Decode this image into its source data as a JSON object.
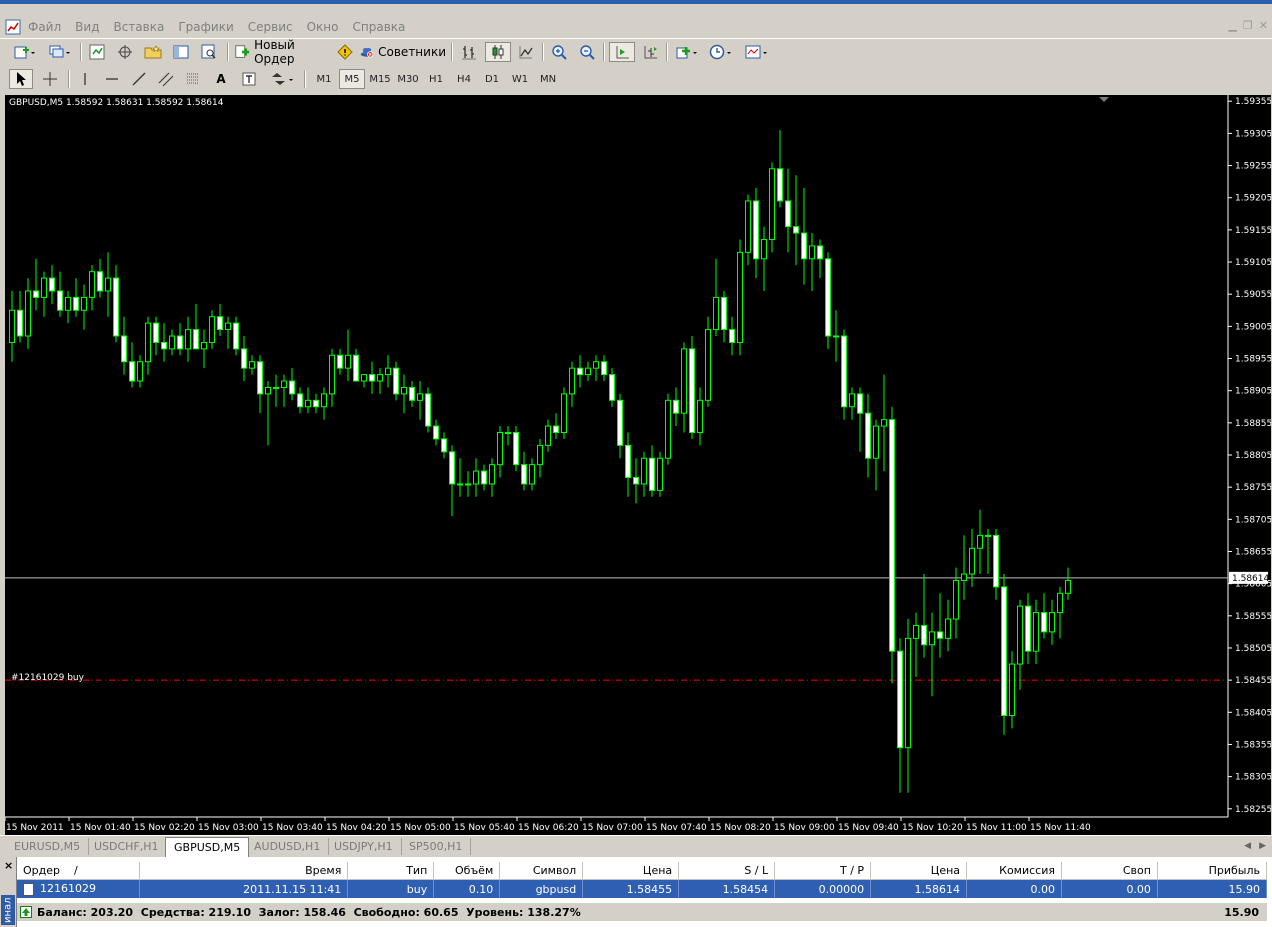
{
  "menu": [
    "Файл",
    "Вид",
    "Вставка",
    "Графики",
    "Сервис",
    "Окно",
    "Справка"
  ],
  "toolbar": {
    "new_order_label": "Новый Ордер",
    "advisors_label": "Советники",
    "timeframes": [
      "M1",
      "M5",
      "M15",
      "M30",
      "H1",
      "H4",
      "D1",
      "W1",
      "MN"
    ],
    "active_timeframe": "M5",
    "text_tool_label": "A"
  },
  "chart": {
    "title": "GBPUSD,M5  1.58592 1.58631 1.58592 1.58614",
    "order_line_label": "#12161029 buy",
    "current_price_label": "1.58614",
    "colors": {
      "background": "#000000",
      "candle": "#00ff00",
      "order_line": "#ff0000",
      "price_line": "#c0c0c0",
      "axis_text": "#ffffff"
    }
  },
  "chart_data": {
    "type": "candlestick",
    "symbol": "GBPUSD",
    "timeframe": "M5",
    "x_axis_labels": [
      "15 Nov 2011",
      "15 Nov 01:40",
      "15 Nov 02:20",
      "15 Nov 03:00",
      "15 Nov 03:40",
      "15 Nov 04:20",
      "15 Nov 05:00",
      "15 Nov 05:40",
      "15 Nov 06:20",
      "15 Nov 07:00",
      "15 Nov 07:40",
      "15 Nov 08:20",
      "15 Nov 09:00",
      "15 Nov 09:40",
      "15 Nov 10:20",
      "15 Nov 11:00",
      "15 Nov 11:40"
    ],
    "y_ticks": [
      "1.59355",
      "1.59305",
      "1.59255",
      "1.59205",
      "1.59155",
      "1.59105",
      "1.59055",
      "1.59005",
      "1.58955",
      "1.58905",
      "1.58855",
      "1.58805",
      "1.58755",
      "1.58705",
      "1.58655",
      "1.58605",
      "1.58555",
      "1.58505",
      "1.58455",
      "1.58405",
      "1.58355",
      "1.58305",
      "1.58255"
    ],
    "ylim": [
      1.5825,
      1.5936
    ],
    "current_price": 1.58614,
    "order_price": 1.58455,
    "candles_comment": "t = minutes elapsed from the first tick label 15 Nov 2011 (00:xx) at the leftmost edge; each candle is 5 minutes",
    "candles": [
      {
        "t": 0,
        "o": 1.5898,
        "h": 1.5906,
        "l": 1.5895,
        "c": 1.5903
      },
      {
        "t": 5,
        "o": 1.5903,
        "h": 1.5906,
        "l": 1.5898,
        "c": 1.5899
      },
      {
        "t": 10,
        "o": 1.5899,
        "h": 1.5908,
        "l": 1.5897,
        "c": 1.5906
      },
      {
        "t": 15,
        "o": 1.5906,
        "h": 1.5911,
        "l": 1.5903,
        "c": 1.5905
      },
      {
        "t": 20,
        "o": 1.5905,
        "h": 1.5909,
        "l": 1.5902,
        "c": 1.5908
      },
      {
        "t": 25,
        "o": 1.5908,
        "h": 1.591,
        "l": 1.5904,
        "c": 1.5906
      },
      {
        "t": 30,
        "o": 1.5906,
        "h": 1.5909,
        "l": 1.5902,
        "c": 1.5903
      },
      {
        "t": 35,
        "o": 1.5903,
        "h": 1.5906,
        "l": 1.5901,
        "c": 1.5905
      },
      {
        "t": 40,
        "o": 1.5905,
        "h": 1.5908,
        "l": 1.5902,
        "c": 1.5903
      },
      {
        "t": 45,
        "o": 1.5903,
        "h": 1.5907,
        "l": 1.59,
        "c": 1.5905
      },
      {
        "t": 50,
        "o": 1.5905,
        "h": 1.591,
        "l": 1.5903,
        "c": 1.5909
      },
      {
        "t": 55,
        "o": 1.5909,
        "h": 1.5911,
        "l": 1.5905,
        "c": 1.5906
      },
      {
        "t": 60,
        "o": 1.5906,
        "h": 1.5912,
        "l": 1.5902,
        "c": 1.5908
      },
      {
        "t": 65,
        "o": 1.5908,
        "h": 1.591,
        "l": 1.5898,
        "c": 1.5899
      },
      {
        "t": 70,
        "o": 1.5899,
        "h": 1.5902,
        "l": 1.5893,
        "c": 1.5895
      },
      {
        "t": 75,
        "o": 1.5895,
        "h": 1.5898,
        "l": 1.5891,
        "c": 1.5892
      },
      {
        "t": 80,
        "o": 1.5892,
        "h": 1.5896,
        "l": 1.5891,
        "c": 1.5895
      },
      {
        "t": 85,
        "o": 1.5895,
        "h": 1.5902,
        "l": 1.5893,
        "c": 1.5901
      },
      {
        "t": 90,
        "o": 1.5901,
        "h": 1.5902,
        "l": 1.5896,
        "c": 1.5898
      },
      {
        "t": 95,
        "o": 1.5898,
        "h": 1.5901,
        "l": 1.5895,
        "c": 1.5897
      },
      {
        "t": 100,
        "o": 1.5897,
        "h": 1.59,
        "l": 1.5896,
        "c": 1.5899
      },
      {
        "t": 105,
        "o": 1.5899,
        "h": 1.5901,
        "l": 1.5896,
        "c": 1.5897
      },
      {
        "t": 110,
        "o": 1.5897,
        "h": 1.5902,
        "l": 1.5895,
        "c": 1.59
      },
      {
        "t": 115,
        "o": 1.59,
        "h": 1.5904,
        "l": 1.5897,
        "c": 1.5897
      },
      {
        "t": 120,
        "o": 1.5897,
        "h": 1.59,
        "l": 1.5894,
        "c": 1.5898
      },
      {
        "t": 125,
        "o": 1.5898,
        "h": 1.5903,
        "l": 1.5897,
        "c": 1.5902
      },
      {
        "t": 130,
        "o": 1.5902,
        "h": 1.5904,
        "l": 1.5899,
        "c": 1.59
      },
      {
        "t": 135,
        "o": 1.59,
        "h": 1.5902,
        "l": 1.5897,
        "c": 1.5901
      },
      {
        "t": 140,
        "o": 1.5901,
        "h": 1.5902,
        "l": 1.5896,
        "c": 1.5897
      },
      {
        "t": 145,
        "o": 1.5897,
        "h": 1.5899,
        "l": 1.5892,
        "c": 1.5894
      },
      {
        "t": 150,
        "o": 1.5894,
        "h": 1.5896,
        "l": 1.5893,
        "c": 1.5895
      },
      {
        "t": 155,
        "o": 1.5895,
        "h": 1.5896,
        "l": 1.5887,
        "c": 1.589
      },
      {
        "t": 160,
        "o": 1.589,
        "h": 1.5892,
        "l": 1.5882,
        "c": 1.5891
      },
      {
        "t": 165,
        "o": 1.5891,
        "h": 1.5893,
        "l": 1.5888,
        "c": 1.5891
      },
      {
        "t": 170,
        "o": 1.5891,
        "h": 1.5893,
        "l": 1.5888,
        "c": 1.5892
      },
      {
        "t": 175,
        "o": 1.5892,
        "h": 1.5894,
        "l": 1.5889,
        "c": 1.589
      },
      {
        "t": 180,
        "o": 1.589,
        "h": 1.5891,
        "l": 1.5887,
        "c": 1.5888
      },
      {
        "t": 185,
        "o": 1.5888,
        "h": 1.5891,
        "l": 1.5887,
        "c": 1.5889
      },
      {
        "t": 190,
        "o": 1.5889,
        "h": 1.589,
        "l": 1.5887,
        "c": 1.5888
      },
      {
        "t": 195,
        "o": 1.5888,
        "h": 1.5891,
        "l": 1.5886,
        "c": 1.589
      },
      {
        "t": 200,
        "o": 1.589,
        "h": 1.5897,
        "l": 1.5888,
        "c": 1.5896
      },
      {
        "t": 205,
        "o": 1.5896,
        "h": 1.5897,
        "l": 1.5893,
        "c": 1.5894
      },
      {
        "t": 210,
        "o": 1.5894,
        "h": 1.59,
        "l": 1.5892,
        "c": 1.5896
      },
      {
        "t": 215,
        "o": 1.5896,
        "h": 1.5897,
        "l": 1.5892,
        "c": 1.5892
      },
      {
        "t": 220,
        "o": 1.5892,
        "h": 1.5893,
        "l": 1.5891,
        "c": 1.5893
      },
      {
        "t": 225,
        "o": 1.5893,
        "h": 1.5895,
        "l": 1.589,
        "c": 1.5892
      },
      {
        "t": 230,
        "o": 1.5892,
        "h": 1.5894,
        "l": 1.589,
        "c": 1.5893
      },
      {
        "t": 235,
        "o": 1.5893,
        "h": 1.5896,
        "l": 1.5891,
        "c": 1.5894
      },
      {
        "t": 240,
        "o": 1.5894,
        "h": 1.5895,
        "l": 1.5889,
        "c": 1.589
      },
      {
        "t": 245,
        "o": 1.589,
        "h": 1.5893,
        "l": 1.5887,
        "c": 1.5891
      },
      {
        "t": 250,
        "o": 1.5891,
        "h": 1.5892,
        "l": 1.5888,
        "c": 1.5889
      },
      {
        "t": 255,
        "o": 1.5889,
        "h": 1.5892,
        "l": 1.5886,
        "c": 1.589
      },
      {
        "t": 260,
        "o": 1.589,
        "h": 1.5891,
        "l": 1.5884,
        "c": 1.5885
      },
      {
        "t": 265,
        "o": 1.5885,
        "h": 1.5886,
        "l": 1.5882,
        "c": 1.5883
      },
      {
        "t": 270,
        "o": 1.5883,
        "h": 1.5884,
        "l": 1.588,
        "c": 1.5881
      },
      {
        "t": 275,
        "o": 1.5881,
        "h": 1.5882,
        "l": 1.5871,
        "c": 1.5876
      },
      {
        "t": 280,
        "o": 1.5876,
        "h": 1.588,
        "l": 1.5874,
        "c": 1.5876
      },
      {
        "t": 285,
        "o": 1.5876,
        "h": 1.5878,
        "l": 1.5874,
        "c": 1.5876
      },
      {
        "t": 290,
        "o": 1.5876,
        "h": 1.588,
        "l": 1.5874,
        "c": 1.5878
      },
      {
        "t": 295,
        "o": 1.5878,
        "h": 1.5879,
        "l": 1.5875,
        "c": 1.5876
      },
      {
        "t": 300,
        "o": 1.5876,
        "h": 1.588,
        "l": 1.5874,
        "c": 1.5879
      },
      {
        "t": 305,
        "o": 1.5879,
        "h": 1.5885,
        "l": 1.5877,
        "c": 1.5884
      },
      {
        "t": 310,
        "o": 1.5884,
        "h": 1.5885,
        "l": 1.5882,
        "c": 1.5884
      },
      {
        "t": 315,
        "o": 1.5884,
        "h": 1.5885,
        "l": 1.5878,
        "c": 1.5879
      },
      {
        "t": 320,
        "o": 1.5879,
        "h": 1.5881,
        "l": 1.5875,
        "c": 1.5876
      },
      {
        "t": 325,
        "o": 1.5876,
        "h": 1.588,
        "l": 1.5875,
        "c": 1.5879
      },
      {
        "t": 330,
        "o": 1.5879,
        "h": 1.5883,
        "l": 1.5877,
        "c": 1.5882
      },
      {
        "t": 335,
        "o": 1.5882,
        "h": 1.5886,
        "l": 1.5881,
        "c": 1.5885
      },
      {
        "t": 340,
        "o": 1.5885,
        "h": 1.5887,
        "l": 1.5883,
        "c": 1.5884
      },
      {
        "t": 345,
        "o": 1.5884,
        "h": 1.5891,
        "l": 1.5883,
        "c": 1.589
      },
      {
        "t": 350,
        "o": 1.589,
        "h": 1.5895,
        "l": 1.5888,
        "c": 1.5894
      },
      {
        "t": 355,
        "o": 1.5894,
        "h": 1.5896,
        "l": 1.5891,
        "c": 1.5893
      },
      {
        "t": 360,
        "o": 1.5893,
        "h": 1.5895,
        "l": 1.5892,
        "c": 1.5894
      },
      {
        "t": 365,
        "o": 1.5894,
        "h": 1.5896,
        "l": 1.5892,
        "c": 1.5895
      },
      {
        "t": 370,
        "o": 1.5895,
        "h": 1.5896,
        "l": 1.5892,
        "c": 1.5893
      },
      {
        "t": 375,
        "o": 1.5893,
        "h": 1.5894,
        "l": 1.5888,
        "c": 1.5889
      },
      {
        "t": 380,
        "o": 1.5889,
        "h": 1.589,
        "l": 1.588,
        "c": 1.5882
      },
      {
        "t": 385,
        "o": 1.5882,
        "h": 1.5884,
        "l": 1.5874,
        "c": 1.5877
      },
      {
        "t": 390,
        "o": 1.5877,
        "h": 1.588,
        "l": 1.5873,
        "c": 1.5876
      },
      {
        "t": 395,
        "o": 1.5876,
        "h": 1.5881,
        "l": 1.5874,
        "c": 1.588
      },
      {
        "t": 400,
        "o": 1.588,
        "h": 1.5882,
        "l": 1.5874,
        "c": 1.5875
      },
      {
        "t": 405,
        "o": 1.5875,
        "h": 1.5881,
        "l": 1.5874,
        "c": 1.588
      },
      {
        "t": 410,
        "o": 1.588,
        "h": 1.589,
        "l": 1.5879,
        "c": 1.5889
      },
      {
        "t": 415,
        "o": 1.5889,
        "h": 1.5891,
        "l": 1.5885,
        "c": 1.5887
      },
      {
        "t": 420,
        "o": 1.5887,
        "h": 1.5898,
        "l": 1.5884,
        "c": 1.5897
      },
      {
        "t": 425,
        "o": 1.5897,
        "h": 1.5899,
        "l": 1.5883,
        "c": 1.5884
      },
      {
        "t": 430,
        "o": 1.5884,
        "h": 1.5891,
        "l": 1.5882,
        "c": 1.5889
      },
      {
        "t": 435,
        "o": 1.5889,
        "h": 1.5902,
        "l": 1.5888,
        "c": 1.59
      },
      {
        "t": 440,
        "o": 1.59,
        "h": 1.5911,
        "l": 1.5899,
        "c": 1.5905
      },
      {
        "t": 445,
        "o": 1.5905,
        "h": 1.5906,
        "l": 1.5898,
        "c": 1.59
      },
      {
        "t": 450,
        "o": 1.59,
        "h": 1.5902,
        "l": 1.5896,
        "c": 1.5898
      },
      {
        "t": 455,
        "o": 1.5898,
        "h": 1.5914,
        "l": 1.5896,
        "c": 1.5912
      },
      {
        "t": 460,
        "o": 1.5912,
        "h": 1.5921,
        "l": 1.591,
        "c": 1.592
      },
      {
        "t": 465,
        "o": 1.592,
        "h": 1.5922,
        "l": 1.5908,
        "c": 1.5911
      },
      {
        "t": 470,
        "o": 1.5911,
        "h": 1.5916,
        "l": 1.5906,
        "c": 1.5914
      },
      {
        "t": 475,
        "o": 1.5914,
        "h": 1.5926,
        "l": 1.5912,
        "c": 1.5925
      },
      {
        "t": 480,
        "o": 1.5925,
        "h": 1.5931,
        "l": 1.5919,
        "c": 1.592
      },
      {
        "t": 485,
        "o": 1.592,
        "h": 1.5925,
        "l": 1.5912,
        "c": 1.5916
      },
      {
        "t": 490,
        "o": 1.5916,
        "h": 1.5924,
        "l": 1.591,
        "c": 1.5915
      },
      {
        "t": 495,
        "o": 1.5915,
        "h": 1.5922,
        "l": 1.5907,
        "c": 1.5911
      },
      {
        "t": 500,
        "o": 1.5911,
        "h": 1.5915,
        "l": 1.5906,
        "c": 1.5913
      },
      {
        "t": 505,
        "o": 1.5913,
        "h": 1.5914,
        "l": 1.5908,
        "c": 1.5911
      },
      {
        "t": 510,
        "o": 1.5911,
        "h": 1.5912,
        "l": 1.5897,
        "c": 1.5899
      },
      {
        "t": 515,
        "o": 1.5899,
        "h": 1.5903,
        "l": 1.5895,
        "c": 1.5899
      },
      {
        "t": 520,
        "o": 1.5899,
        "h": 1.59,
        "l": 1.5886,
        "c": 1.5888
      },
      {
        "t": 525,
        "o": 1.5888,
        "h": 1.5891,
        "l": 1.5886,
        "c": 1.589
      },
      {
        "t": 530,
        "o": 1.589,
        "h": 1.5891,
        "l": 1.5881,
        "c": 1.5887
      },
      {
        "t": 535,
        "o": 1.5887,
        "h": 1.589,
        "l": 1.5877,
        "c": 1.588
      },
      {
        "t": 540,
        "o": 1.588,
        "h": 1.5886,
        "l": 1.5875,
        "c": 1.5885
      },
      {
        "t": 545,
        "o": 1.5885,
        "h": 1.5893,
        "l": 1.5878,
        "c": 1.5886
      },
      {
        "t": 550,
        "o": 1.5886,
        "h": 1.5888,
        "l": 1.5845,
        "c": 1.585
      },
      {
        "t": 555,
        "o": 1.585,
        "h": 1.5852,
        "l": 1.5828,
        "c": 1.5835
      },
      {
        "t": 560,
        "o": 1.5835,
        "h": 1.5855,
        "l": 1.5828,
        "c": 1.5852
      },
      {
        "t": 565,
        "o": 1.5852,
        "h": 1.5856,
        "l": 1.5846,
        "c": 1.5854
      },
      {
        "t": 570,
        "o": 1.5854,
        "h": 1.5862,
        "l": 1.5849,
        "c": 1.5851
      },
      {
        "t": 575,
        "o": 1.5851,
        "h": 1.5856,
        "l": 1.5843,
        "c": 1.5853
      },
      {
        "t": 580,
        "o": 1.5853,
        "h": 1.5859,
        "l": 1.5849,
        "c": 1.5852
      },
      {
        "t": 585,
        "o": 1.5852,
        "h": 1.5858,
        "l": 1.585,
        "c": 1.5855
      },
      {
        "t": 590,
        "o": 1.5855,
        "h": 1.5863,
        "l": 1.5852,
        "c": 1.5861
      },
      {
        "t": 595,
        "o": 1.5861,
        "h": 1.5868,
        "l": 1.5858,
        "c": 1.5862
      },
      {
        "t": 600,
        "o": 1.5862,
        "h": 1.5869,
        "l": 1.586,
        "c": 1.5866
      },
      {
        "t": 605,
        "o": 1.5866,
        "h": 1.5872,
        "l": 1.5862,
        "c": 1.5868
      },
      {
        "t": 610,
        "o": 1.5868,
        "h": 1.5869,
        "l": 1.5862,
        "c": 1.5868
      },
      {
        "t": 615,
        "o": 1.5868,
        "h": 1.5869,
        "l": 1.5858,
        "c": 1.586
      },
      {
        "t": 620,
        "o": 1.586,
        "h": 1.5862,
        "l": 1.5837,
        "c": 1.584
      },
      {
        "t": 625,
        "o": 1.584,
        "h": 1.585,
        "l": 1.5838,
        "c": 1.5848
      },
      {
        "t": 630,
        "o": 1.5848,
        "h": 1.5858,
        "l": 1.5844,
        "c": 1.5857
      },
      {
        "t": 635,
        "o": 1.5857,
        "h": 1.5859,
        "l": 1.5848,
        "c": 1.585
      },
      {
        "t": 640,
        "o": 1.585,
        "h": 1.5858,
        "l": 1.5848,
        "c": 1.5856
      },
      {
        "t": 645,
        "o": 1.5856,
        "h": 1.5859,
        "l": 1.5852,
        "c": 1.5853
      },
      {
        "t": 650,
        "o": 1.5853,
        "h": 1.5858,
        "l": 1.5851,
        "c": 1.5856
      },
      {
        "t": 655,
        "o": 1.5856,
        "h": 1.586,
        "l": 1.5852,
        "c": 1.5859
      },
      {
        "t": 660,
        "o": 1.5859,
        "h": 1.5863,
        "l": 1.5858,
        "c": 1.5861
      }
    ]
  },
  "tabs": [
    "EURUSD,M5",
    "USDCHF,H1",
    "GBPUSD,M5",
    "AUDUSD,H1",
    "USDJPY,H1",
    "SP500,H1"
  ],
  "active_tab": "GBPUSD,M5",
  "terminal": {
    "side_label": "инал",
    "columns": [
      "Ордер",
      "/",
      "Время",
      "Тип",
      "Объём",
      "Символ",
      "Цена",
      "S / L",
      "T / P",
      "Цена",
      "Комиссия",
      "Своп",
      "Прибыль"
    ],
    "row": [
      "12161029",
      "2011.11.15 11:41",
      "buy",
      "0.10",
      "gbpusd",
      "1.58455",
      "1.58454",
      "0.00000",
      "1.58614",
      "0.00",
      "0.00",
      "15.90"
    ],
    "balance_line": "Баланс: 203.20  Средства: 219.10  Залог: 158.46  Свободно: 60.65  Уровень: 138.27%",
    "balance_profit": "15.90"
  }
}
